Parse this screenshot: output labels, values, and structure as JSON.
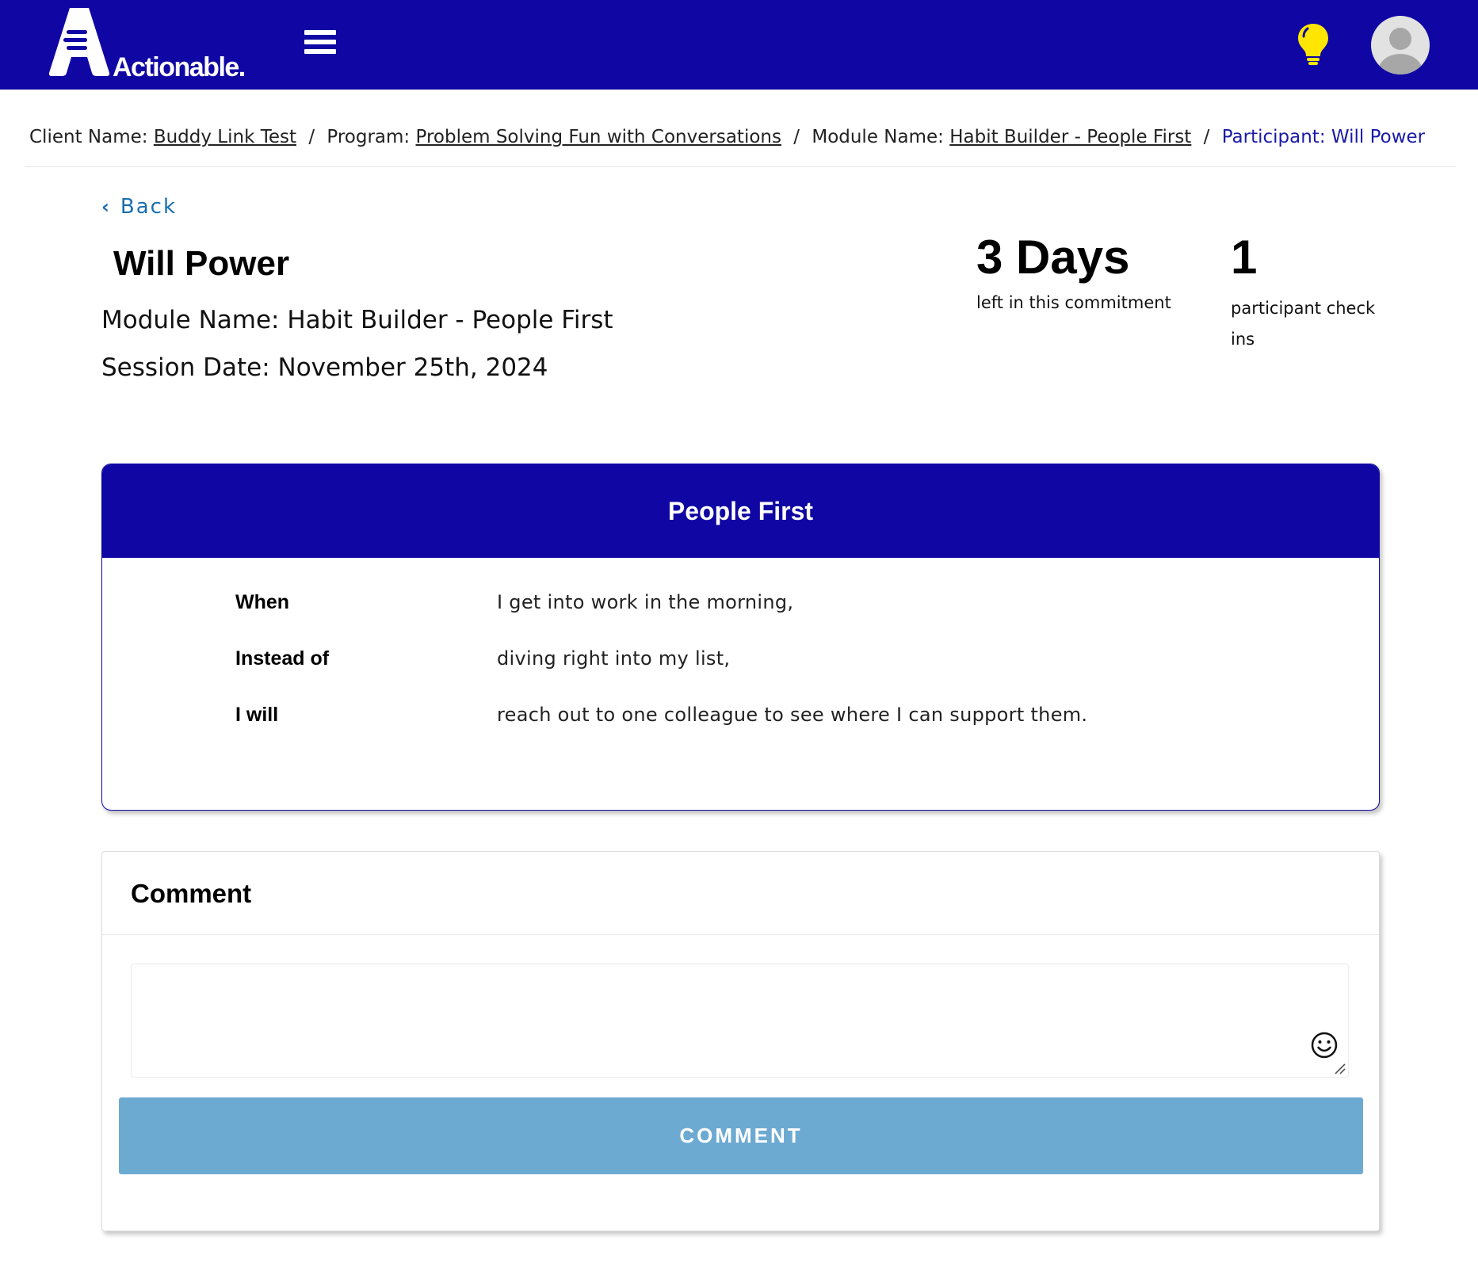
{
  "header": {
    "logo_text": "Actionable.",
    "brand_color": "#0f06a3",
    "icons": [
      "menu-icon",
      "lightbulb-icon",
      "user-avatar-icon"
    ]
  },
  "breadcrumb": {
    "client_label": "Client Name:",
    "client_value": "Buddy Link Test",
    "program_label": "Program:",
    "program_value": "Problem Solving Fun with Conversations",
    "module_label": "Module Name:",
    "module_value": "Habit Builder - People First",
    "participant": "Participant: Will Power",
    "separator": "/"
  },
  "back": {
    "label": "Back"
  },
  "participant": {
    "name": "Will Power",
    "module_line": "Module Name: Habit Builder - People First",
    "session_line": "Session Date: November 25th, 2024"
  },
  "stats": {
    "days_value": "3 Days",
    "days_label": "left in this commitment",
    "checkins_value": "1",
    "checkins_label": "participant check ins"
  },
  "habit": {
    "title": "People First",
    "rows": [
      {
        "key": "When",
        "value": "I get into work in the morning,"
      },
      {
        "key": "Instead of",
        "value": "diving right into my list,"
      },
      {
        "key": "I will",
        "value": "reach out to one colleague to see where I can support them."
      }
    ]
  },
  "comment": {
    "title": "Comment",
    "input_value": "",
    "button_label": "COMMENT",
    "button_color": "#6daad2"
  }
}
